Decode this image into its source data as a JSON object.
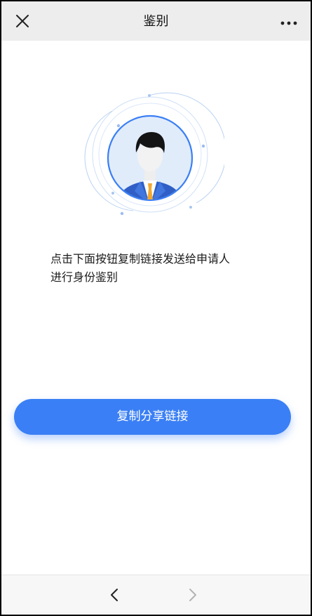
{
  "header": {
    "title": "鉴别",
    "close_icon": "close-icon",
    "more_icon": "more-icon"
  },
  "main": {
    "illustration_icon": "user-avatar-icon",
    "instruction_line1": "点击下面按钮复制链接发送给申请人",
    "instruction_line2": "进行身份鉴别",
    "share_button_label": "复制分享链接"
  },
  "footer": {
    "back_icon": "chevron-left-icon",
    "forward_icon": "chevron-right-icon",
    "forward_enabled": false
  },
  "colors": {
    "accent": "#3a7ff5",
    "nav_bg": "#ededed",
    "footer_bg": "#f7f7f7",
    "text": "#1a1a1a"
  }
}
